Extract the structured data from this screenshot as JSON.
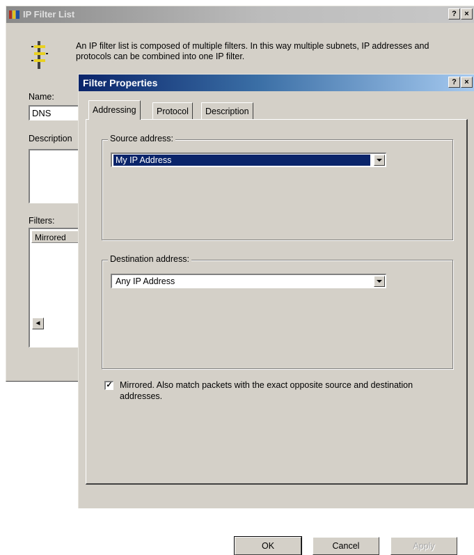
{
  "back_window": {
    "title": "IP Filter List",
    "help_button": "?",
    "close_button": "×",
    "description": "An IP filter list is composed of multiple filters. In this way multiple subnets, IP addresses and protocols can be combined into one IP filter.",
    "name_label": "Name:",
    "name_value": "DNS",
    "description_label": "Description",
    "filters_label": "Filters:",
    "filters_column": "Mirrored"
  },
  "dialog": {
    "title": "Filter Properties",
    "help_button": "?",
    "close_button": "×",
    "tabs": [
      {
        "label": "Addressing",
        "active": true
      },
      {
        "label": "Protocol",
        "active": false
      },
      {
        "label": "Description",
        "active": false
      }
    ],
    "source": {
      "group_label": "Source address:",
      "selected": "My IP Address"
    },
    "destination": {
      "group_label": "Destination address:",
      "selected": "Any IP Address"
    },
    "mirrored": {
      "checked": true,
      "check_mark": "✓",
      "label": "Mirrored. Also match packets with the exact opposite source and destination addresses."
    },
    "buttons": {
      "ok": "OK",
      "cancel": "Cancel",
      "apply": "Apply"
    }
  },
  "colors": {
    "active_title": "#0a246a",
    "face": "#d4d0c8",
    "selection": "#0a246a"
  }
}
